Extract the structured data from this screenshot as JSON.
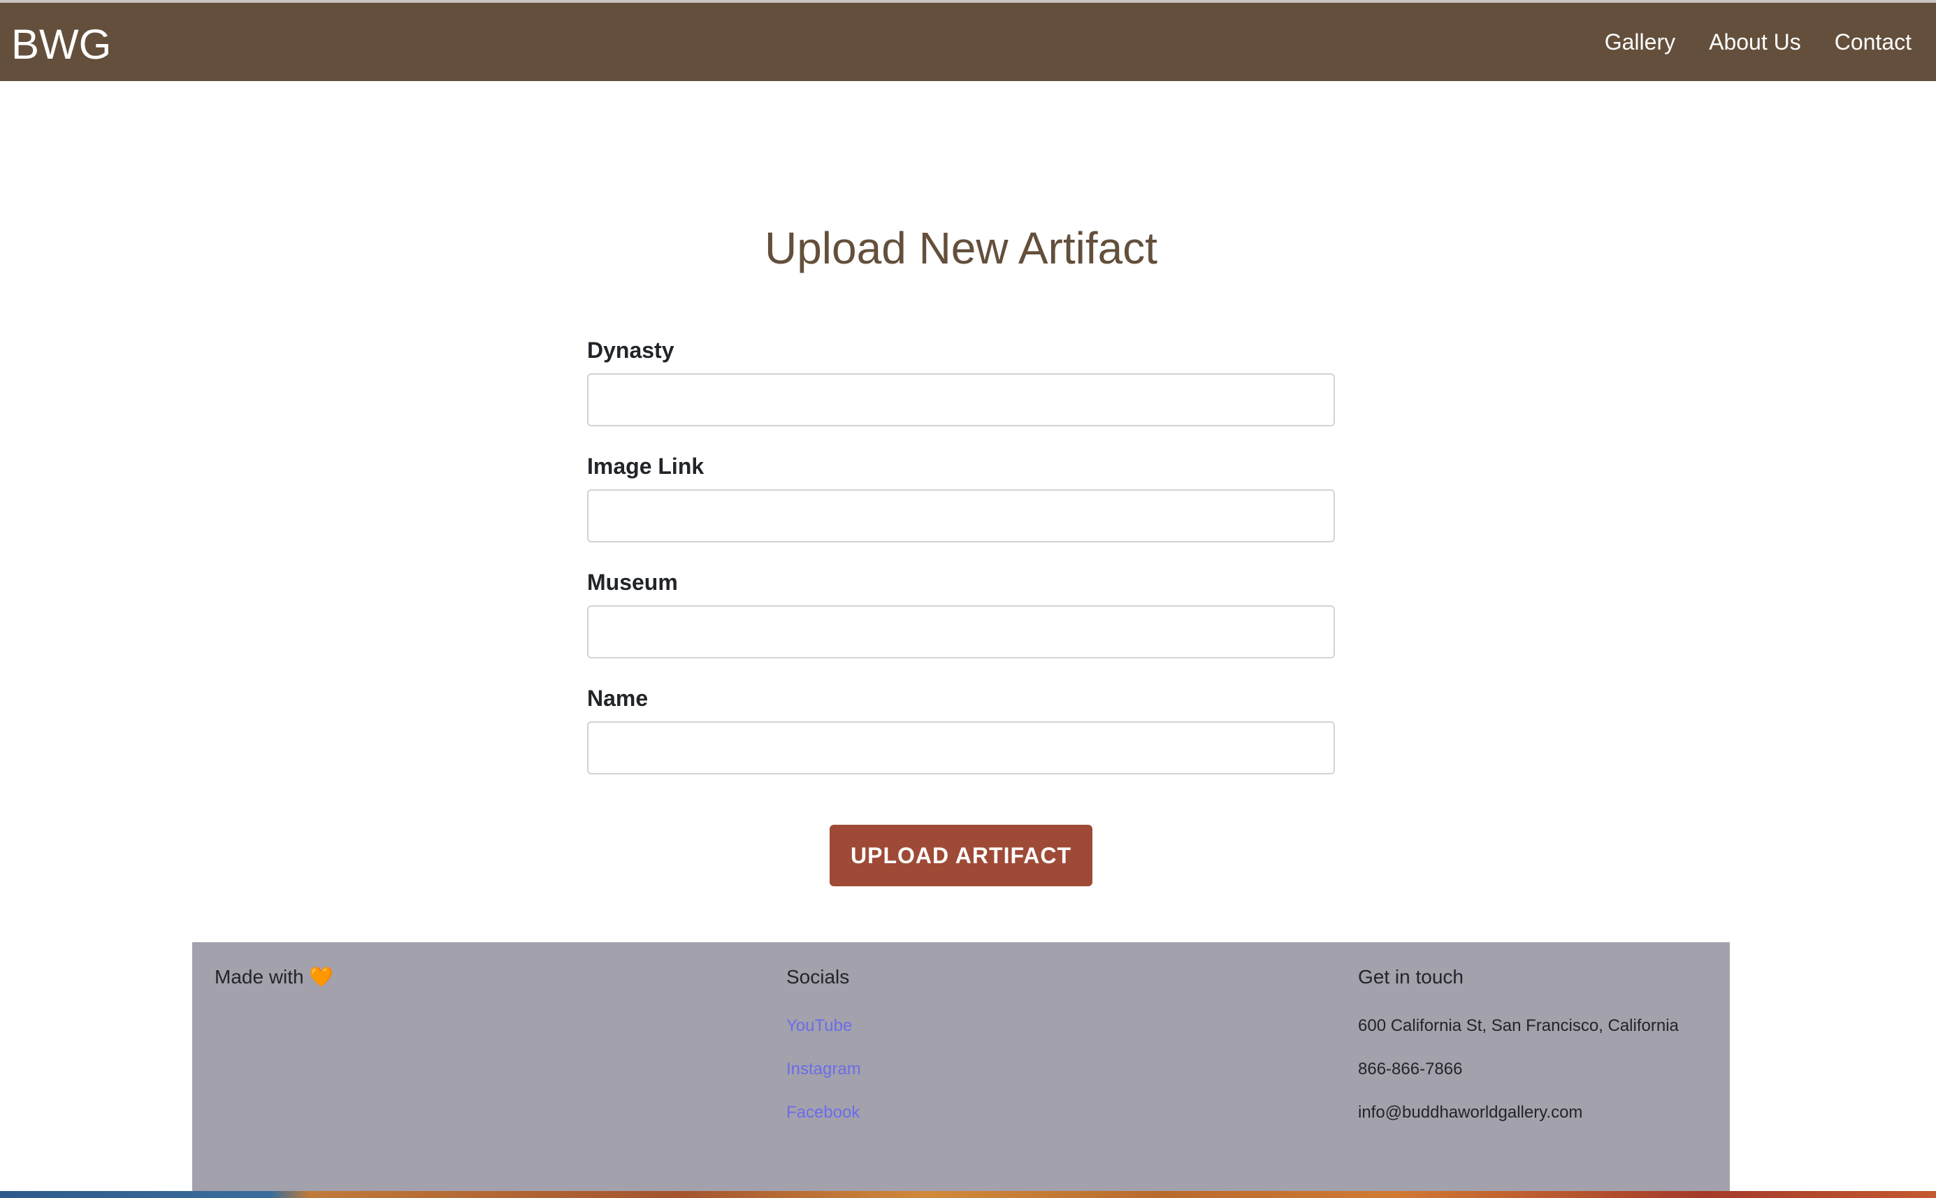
{
  "nav": {
    "brand": "BWG",
    "links": [
      "Gallery",
      "About Us",
      "Contact"
    ]
  },
  "main": {
    "title": "Upload New Artifact",
    "fields": [
      {
        "label": "Dynasty",
        "value": "",
        "placeholder": ""
      },
      {
        "label": "Image Link",
        "value": "",
        "placeholder": ""
      },
      {
        "label": "Museum",
        "value": "",
        "placeholder": ""
      },
      {
        "label": "Name",
        "value": "",
        "placeholder": ""
      }
    ],
    "submit_label": "UPLOAD ARTIFACT"
  },
  "footer": {
    "made_with": "Made with",
    "heart_icon": "heart-icon",
    "heart_glyph": "🧡",
    "socials": {
      "heading": "Socials",
      "links": [
        "YouTube",
        "Instagram",
        "Facebook"
      ]
    },
    "contact": {
      "heading": "Get in touch",
      "address": "600 California St, San Francisco, California",
      "phone": "866-866-7866",
      "email": "info@buddhaworldgallery.com"
    }
  },
  "colors": {
    "nav_bg": "#634f3b",
    "title": "#634f3b",
    "button_bg": "#9e4a36",
    "footer_bg": "#a3a1ab",
    "link": "#6b6dea"
  }
}
